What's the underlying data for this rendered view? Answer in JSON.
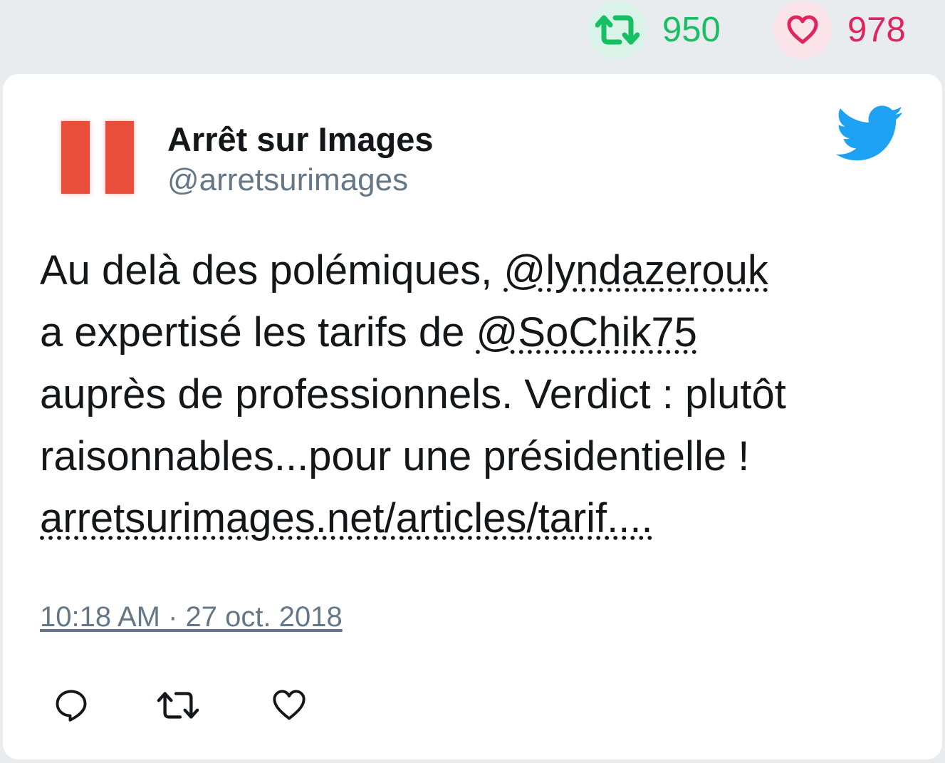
{
  "top_stats": {
    "retweet_count": "950",
    "like_count": "978",
    "retweet_icon": "retweet-icon",
    "like_icon": "heart-icon",
    "retweet_color": "#17bf63",
    "like_color": "#e0245e"
  },
  "tweet": {
    "author": {
      "name": "Arrêt sur Images",
      "handle": "@arretsurimages",
      "avatar_icon": "pause-logo"
    },
    "brand_icon": "twitter-bird-icon",
    "brand_color": "#1da1f2",
    "text": {
      "line1_prefix": "Au delà des polémiques, ",
      "mention1": "@lyndazerouk",
      "line2_prefix": "a expertisé les tarifs de ",
      "mention2": "@SoChik75",
      "line3": "auprès de professionnels. Verdict : plutôt",
      "line4": "raisonnables...pour une présidentielle !",
      "link": "arretsurimages.net/articles/tarif...."
    },
    "timestamp": "10:18 AM · 27 oct. 2018",
    "actions": [
      "reply-icon",
      "retweet-icon",
      "heart-icon"
    ]
  }
}
